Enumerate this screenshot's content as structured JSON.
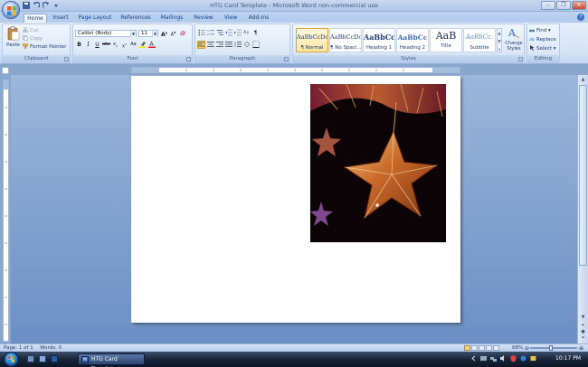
{
  "window": {
    "title": "HTG Card Template - Microsoft Word non-commercial use"
  },
  "tabs": [
    "Home",
    "Insert",
    "Page Layout",
    "References",
    "Mailings",
    "Review",
    "View",
    "Add-Ins"
  ],
  "clipboard": {
    "paste": "Paste",
    "cut": "Cut",
    "copy": "Copy",
    "format_painter": "Format Painter",
    "label": "Clipboard"
  },
  "font": {
    "name": "Calibri (Body)",
    "size": "11",
    "label": "Font"
  },
  "paragraph": {
    "label": "Paragraph"
  },
  "styles": {
    "label": "Styles",
    "items": [
      {
        "sample": "AaBbCcDc",
        "name": "¶ Normal"
      },
      {
        "sample": "AaBbCcDc",
        "name": "¶ No Spaci..."
      },
      {
        "sample": "AaBbCc",
        "name": "Heading 1"
      },
      {
        "sample": "AaBbCc",
        "name": "Heading 2"
      },
      {
        "sample": "AaB",
        "name": "Title"
      },
      {
        "sample": "AaBbCc.",
        "name": "Subtitle"
      }
    ],
    "change_styles": "Change Styles"
  },
  "editing": {
    "find": "Find",
    "replace": "Replace",
    "select": "Select",
    "label": "Editing"
  },
  "status": {
    "page": "Page: 1 of 1",
    "words": "Words: 0",
    "zoom": "68%"
  },
  "taskbar": {
    "task": "HTG Card Template...",
    "clock": "10:17 PM"
  }
}
